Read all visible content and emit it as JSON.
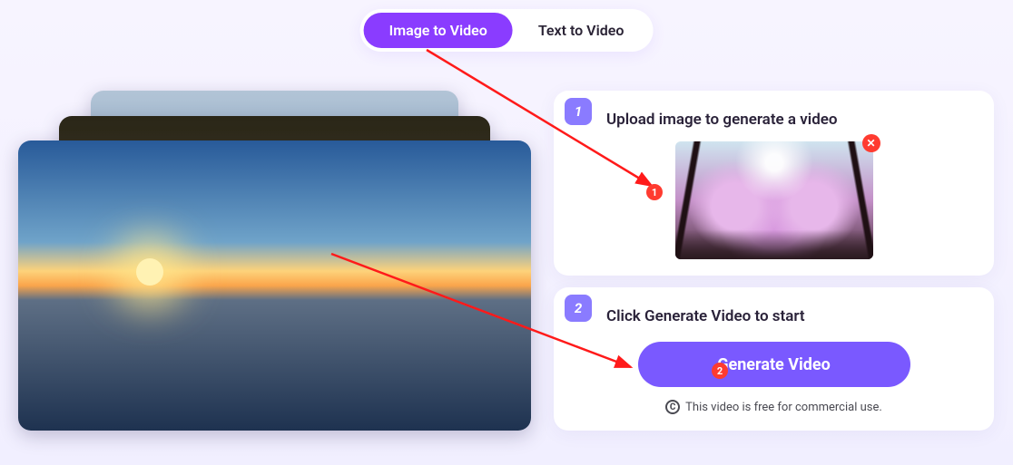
{
  "tabs": {
    "image_to_video": "Image to Video",
    "text_to_video": "Text to Video"
  },
  "step1": {
    "badge": "1",
    "title": "Upload image to generate a video",
    "remove_label": "✕"
  },
  "step2": {
    "badge": "2",
    "title": "Click Generate Video to start",
    "button_label": "Generate Video",
    "footer": "This video is free for commercial use."
  },
  "annotations": {
    "marker1": "1",
    "marker2": "2"
  }
}
